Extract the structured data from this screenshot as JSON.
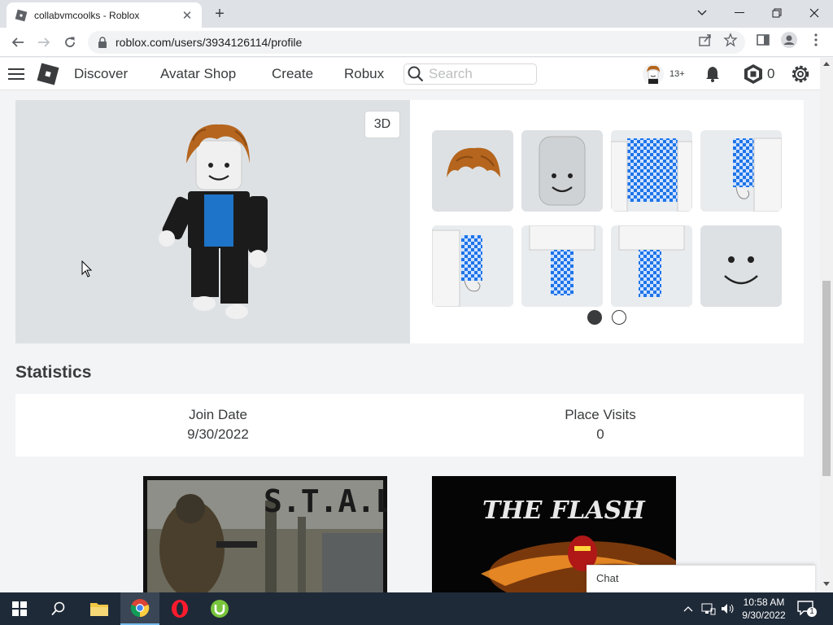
{
  "browser": {
    "tab_title": "collabvmcoolks - Roblox",
    "url": "roblox.com/users/3934126114/profile"
  },
  "nav": {
    "links": [
      "Discover",
      "Avatar Shop",
      "Create",
      "Robux"
    ],
    "search_placeholder": "Search",
    "age_badge": "13+",
    "robux_count": "0"
  },
  "avatar": {
    "view_toggle": "3D",
    "items": [
      "hair",
      "head",
      "torso",
      "right-arm",
      "left-arm",
      "left-leg",
      "right-leg",
      "face"
    ],
    "page_indicator": {
      "current": 1,
      "total": 2
    }
  },
  "statistics": {
    "title": "Statistics",
    "join_date_label": "Join Date",
    "join_date": "9/30/2022",
    "place_visits_label": "Place Visits",
    "place_visits": "0"
  },
  "games": [
    {
      "title": "S.T.A.L.K.E.R"
    },
    {
      "title": "THE FLASH"
    }
  ],
  "chat": {
    "label": "Chat"
  },
  "taskbar": {
    "time": "10:58 AM",
    "date": "9/30/2022",
    "notification_count": "1"
  },
  "colors": {
    "nav_bg": "#ffffff",
    "panel_gray": "#dde1e4",
    "taskbar": "#1f2a38",
    "accent_blue": "#1e74e8"
  }
}
